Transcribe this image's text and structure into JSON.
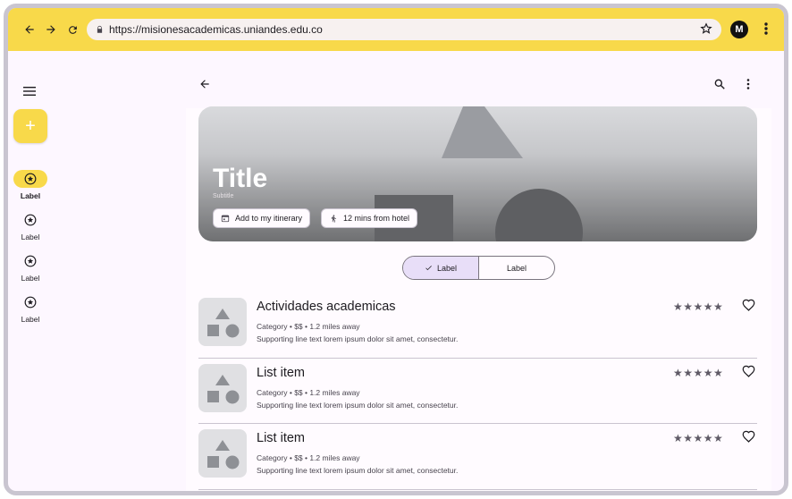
{
  "browser": {
    "url": "https://misionesacademicas.uniandes.edu.co",
    "avatar_initial": "M"
  },
  "rail": {
    "items": [
      {
        "label": "Label",
        "active": true
      },
      {
        "label": "Label",
        "active": false
      },
      {
        "label": "Label",
        "active": false
      },
      {
        "label": "Label",
        "active": false
      }
    ]
  },
  "hero": {
    "title": "Title",
    "subtitle": "Subtitle",
    "chip_itinerary": "Add to my itinerary",
    "chip_distance": "12 mins from hotel"
  },
  "segmented": {
    "option_1": "Label",
    "option_2": "Label",
    "selected_index": 0
  },
  "list": [
    {
      "title": "Actividades academicas",
      "meta": "Category • $$ • 1.2 miles away",
      "support": "Supporting line text lorem ipsum dolor sit amet, consectetur.",
      "rating": "★★★★★"
    },
    {
      "title": "List item",
      "meta": "Category • $$ • 1.2 miles away",
      "support": "Supporting line text lorem ipsum dolor sit amet, consectetur.",
      "rating": "★★★★★"
    },
    {
      "title": "List item",
      "meta": "Category • $$ • 1.2 miles away",
      "support": "Supporting line text lorem ipsum dolor sit amet, consectetur.",
      "rating": "★★★★★"
    }
  ],
  "colors": {
    "accent": "#f8d94a",
    "selected_segment": "#e8def8",
    "surface": "#fdf7ff"
  },
  "icons": [
    "back-arrow-icon",
    "forward-arrow-icon",
    "reload-icon",
    "lock-icon",
    "star-bookmark-icon",
    "more-vert-icon",
    "hamburger-icon",
    "plus-icon",
    "star-circle-icon",
    "search-icon",
    "calendar-icon",
    "walk-icon",
    "check-icon",
    "heart-icon"
  ]
}
